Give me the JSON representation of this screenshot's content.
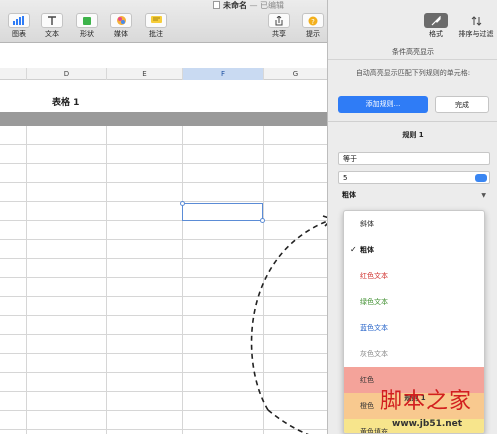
{
  "window": {
    "title": "未命名",
    "separator": "—",
    "status": "已编辑"
  },
  "toolbar": {
    "items": [
      {
        "label": "图表",
        "icon": "chart-icon"
      },
      {
        "label": "文本",
        "icon": "text-icon"
      },
      {
        "label": "形状",
        "icon": "shape-icon"
      },
      {
        "label": "媒体",
        "icon": "media-icon"
      },
      {
        "label": "批注",
        "icon": "comment-icon"
      },
      {
        "label": "共享",
        "icon": "share-icon"
      },
      {
        "label": "提示",
        "icon": "tips-icon"
      }
    ]
  },
  "inspector": {
    "tabs": [
      {
        "label": "格式",
        "icon": "format-icon",
        "active": true
      },
      {
        "label": "排序与过滤",
        "icon": "sort-filter-icon",
        "active": false
      }
    ],
    "header": "条件高亮显示",
    "description": "自动高亮显示匹配下列规则的单元格:",
    "add_rule_label": "添加规则...",
    "done_label": "完成",
    "rule_title": "规则 1",
    "condition": "等于",
    "value": "5",
    "style_selected": "粗体"
  },
  "sheet": {
    "columns": [
      "D",
      "E",
      "F",
      "G"
    ],
    "active_column": "F",
    "table_title": "表格 1"
  },
  "dropdown": {
    "items": [
      {
        "label": "斜体",
        "color": "#222222",
        "checked": false,
        "bold": false
      },
      {
        "label": "粗体",
        "color": "#111111",
        "checked": true,
        "bold": true
      },
      {
        "label": "红色文本",
        "color": "#d0312d",
        "checked": false,
        "bold": false
      },
      {
        "label": "绿色文本",
        "color": "#3f8f2f",
        "checked": false,
        "bold": false
      },
      {
        "label": "蓝色文本",
        "color": "#2563c9",
        "checked": false,
        "bold": false
      },
      {
        "label": "灰色文本",
        "color": "#8a8a8a",
        "checked": false,
        "bold": false
      },
      {
        "label": "红色",
        "color": "#333333",
        "checked": false,
        "bold": false,
        "fill": "#f4a39a"
      },
      {
        "label": "橙色",
        "color": "#333333",
        "checked": false,
        "bold": false,
        "fill": "#f8c98f"
      },
      {
        "label": "黄色填充",
        "color": "#333333",
        "checked": false,
        "bold": false,
        "fill": "#f7e58c"
      }
    ],
    "preview_label": "规则 1"
  },
  "watermark": {
    "text": "脚本之家",
    "url": "www.jb51.net"
  },
  "colors": {
    "accent": "#2f7cf6",
    "selection": "#5b8cd6"
  }
}
